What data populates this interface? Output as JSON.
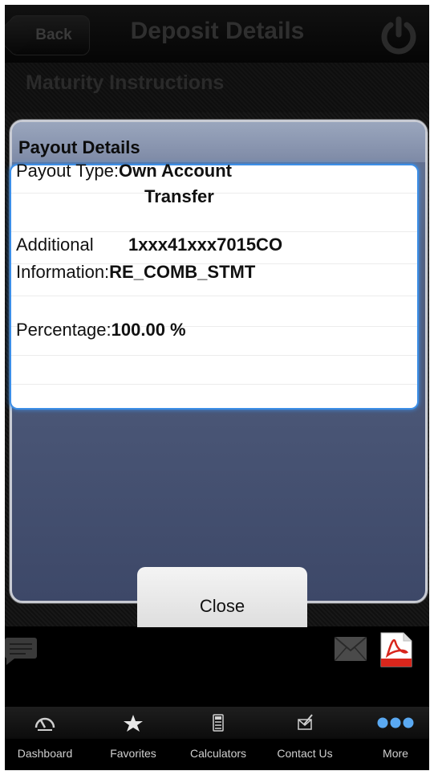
{
  "nav": {
    "back_label": "Back",
    "title": "Deposit Details"
  },
  "section": {
    "title": "Maturity Instructions"
  },
  "popup": {
    "title": "Payout Details",
    "payout_type_key": "Payout Type:",
    "payout_type_value_1": "Own Account",
    "payout_type_value_2": "Transfer",
    "additional_key_1": "Additional",
    "additional_value_1": "1xxx41xxx7015CO",
    "additional_key_2": "Information:",
    "additional_value_2": "RE_COMB_STMT",
    "percentage_key": "Percentage:",
    "percentage_value": "100.00 %",
    "close_label": "Close"
  },
  "tabbar": {
    "items": [
      {
        "label": "Dashboard",
        "icon": "dashboard-gauge-icon"
      },
      {
        "label": "Favorites",
        "icon": "star-icon"
      },
      {
        "label": "Calculators",
        "icon": "calculator-icon"
      },
      {
        "label": "Contact Us",
        "icon": "contact-icon"
      },
      {
        "label": "More",
        "icon": "more-dots-icon"
      }
    ]
  },
  "colors": {
    "accent_blue": "#3c8ee6",
    "popup_blue": "#556282",
    "pdf_red": "#d8261c"
  }
}
